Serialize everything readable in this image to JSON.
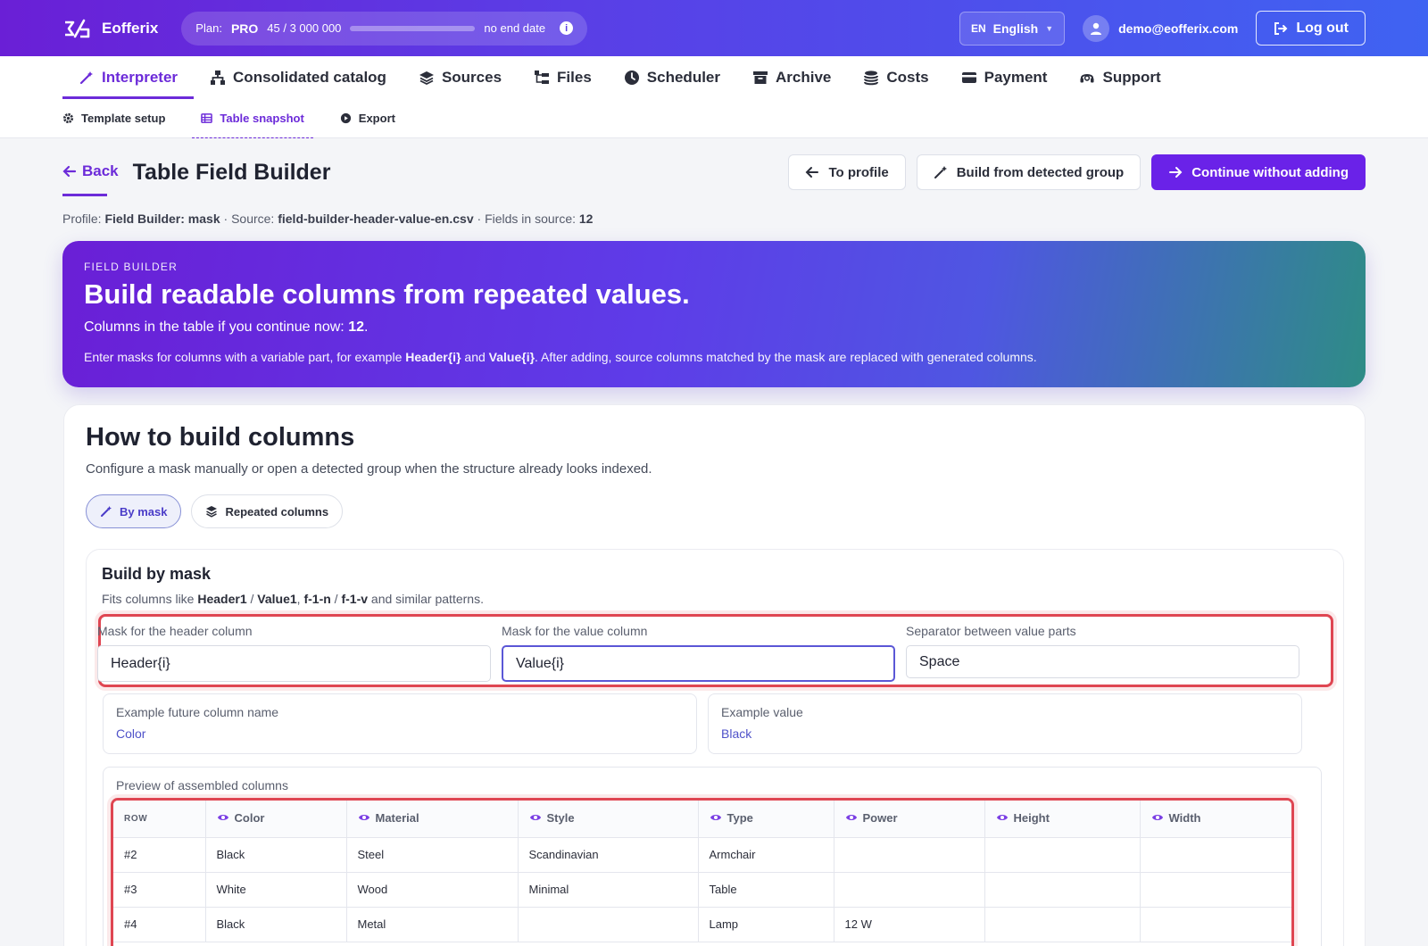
{
  "topbar": {
    "brand": "Eofferix",
    "plan_label": "Plan:",
    "plan_name": "PRO",
    "usage": "45  /  3 000 000",
    "usage_fraction": 1.5e-05,
    "end_date": "no end date",
    "info_glyph": "i",
    "lang_code": "EN",
    "lang_name": "English",
    "user_email": "demo@eofferix.com",
    "logout_label": "Log out"
  },
  "mainnav": [
    {
      "label": "Interpreter",
      "icon": "wand-icon",
      "active": true
    },
    {
      "label": "Consolidated catalog",
      "icon": "sitemap-icon"
    },
    {
      "label": "Sources",
      "icon": "layers-icon"
    },
    {
      "label": "Files",
      "icon": "folder-tree-icon"
    },
    {
      "label": "Scheduler",
      "icon": "clock-icon"
    },
    {
      "label": "Archive",
      "icon": "archive-icon"
    },
    {
      "label": "Costs",
      "icon": "coins-icon"
    },
    {
      "label": "Payment",
      "icon": "credit-card-icon"
    },
    {
      "label": "Support",
      "icon": "headset-icon"
    }
  ],
  "subnav": [
    {
      "label": "Template setup",
      "icon": "gear-icon"
    },
    {
      "label": "Table snapshot",
      "icon": "table-icon",
      "active": true
    },
    {
      "label": "Export",
      "icon": "play-circle-icon"
    }
  ],
  "header": {
    "back_label": "Back",
    "title": "Table Field Builder",
    "to_profile_label": "To profile",
    "build_group_label": "Build from detected group",
    "continue_label": "Continue without adding"
  },
  "meta": {
    "profile_label": "Profile:",
    "profile_value": "Field Builder: mask",
    "source_label": "· Source:",
    "source_value": "field-builder-header-value-en.csv",
    "fields_label": "· Fields in source:",
    "fields_value": "12"
  },
  "hero": {
    "eyebrow": "FIELD BUILDER",
    "headline": "Build readable columns from repeated values.",
    "columns_text": "Columns in the table if you continue now:",
    "columns_count": "12",
    "note_1": "Enter masks for columns with a variable part, for example",
    "note_header": "Header{i}",
    "note_and": "and",
    "note_value": "Value{i}",
    "note_2": ". After adding, source columns matched by the mask are replaced with generated columns."
  },
  "how": {
    "title": "How to build columns",
    "description": "Configure a mask manually or open a detected group when the structure already looks indexed.",
    "tab_mask": "By mask",
    "tab_repeated": "Repeated columns"
  },
  "mask": {
    "title": "Build by mask",
    "hint_1": "Fits columns like",
    "hint_h1": "Header1",
    "hint_slash": "/",
    "hint_v1": "Value1",
    "hint_comma": ",",
    "hint_f1n": "f-1-n",
    "hint_f1v": "f-1-v",
    "hint_2": "and similar patterns.",
    "header_label": "Mask for the header column",
    "header_value": "Header{i}",
    "value_label": "Mask for the value column",
    "value_value": "Value{i}",
    "separator_label": "Separator between value parts",
    "separator_value": "Space",
    "example_name_label": "Example future column name",
    "example_name_value": "Color",
    "example_value_label": "Example value",
    "example_value_value": "Black"
  },
  "preview": {
    "label": "Preview of assembled columns",
    "columns": [
      "ROW",
      "Color",
      "Material",
      "Style",
      "Type",
      "Power",
      "Height",
      "Width"
    ],
    "rows": [
      [
        "#2",
        "Black",
        "Steel",
        "Scandinavian",
        "Armchair",
        "",
        "",
        ""
      ],
      [
        "#3",
        "White",
        "Wood",
        "Minimal",
        "Table",
        "",
        "",
        ""
      ],
      [
        "#4",
        "Black",
        "Metal",
        "",
        "Lamp",
        "12 W",
        "",
        ""
      ]
    ]
  },
  "colors": {
    "accent": "#6a22e8",
    "highlight": "#df4652"
  }
}
